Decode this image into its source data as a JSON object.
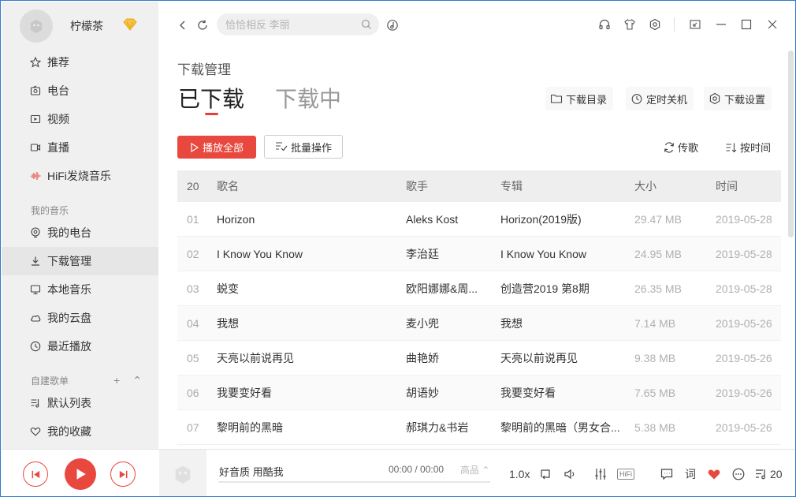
{
  "profile": {
    "username": "柠檬茶"
  },
  "sidebar": {
    "items": [
      {
        "label": "推荐",
        "icon": "star-icon"
      },
      {
        "label": "电台",
        "icon": "radio-icon"
      },
      {
        "label": "视频",
        "icon": "video-icon"
      },
      {
        "label": "直播",
        "icon": "live-icon"
      },
      {
        "label": "HiFi发烧音乐",
        "icon": "hifi-wave-icon"
      }
    ],
    "my_music_title": "我的音乐",
    "my_music": [
      {
        "label": "我的电台",
        "icon": "my-radio-icon"
      },
      {
        "label": "下载管理",
        "icon": "download-icon",
        "active": true
      },
      {
        "label": "本地音乐",
        "icon": "monitor-icon"
      },
      {
        "label": "我的云盘",
        "icon": "cloud-icon"
      },
      {
        "label": "最近播放",
        "icon": "clock-icon"
      }
    ],
    "playlist_title": "自建歌单",
    "playlists": [
      {
        "label": "默认列表",
        "icon": "playlist-icon"
      },
      {
        "label": "我的收藏",
        "icon": "heart-outline-icon"
      }
    ]
  },
  "search": {
    "placeholder": "恰恰相反 李丽"
  },
  "main": {
    "page_title": "下载管理",
    "tabs": [
      "已下载",
      "下载中"
    ],
    "actions": [
      "下载目录",
      "定时关机",
      "下载设置"
    ],
    "play_all": "播放全部",
    "batch": "批量操作",
    "sort_by_song": "传歌",
    "sort_by_time": "按时间"
  },
  "table": {
    "count": "20",
    "headers": [
      "歌名",
      "歌手",
      "专辑",
      "大小",
      "时间"
    ],
    "rows": [
      {
        "idx": "01",
        "name": "Horizon",
        "artist": "Aleks Kost",
        "album": "Horizon(2019版)",
        "size": "29.47 MB",
        "time": "2019-05-28"
      },
      {
        "idx": "02",
        "name": "I Know You Know",
        "artist": "李治廷",
        "album": "I Know You Know",
        "size": "24.95 MB",
        "time": "2019-05-28"
      },
      {
        "idx": "03",
        "name": "蜕变",
        "artist": "欧阳娜娜&周...",
        "album": "创造营2019 第8期",
        "size": "26.35 MB",
        "time": "2019-05-28"
      },
      {
        "idx": "04",
        "name": "我想",
        "artist": "麦小兜",
        "album": "我想",
        "size": "7.14 MB",
        "time": "2019-05-26"
      },
      {
        "idx": "05",
        "name": "天亮以前说再见",
        "artist": "曲艳娇",
        "album": "天亮以前说再见",
        "size": "9.38 MB",
        "time": "2019-05-26"
      },
      {
        "idx": "06",
        "name": "我要变好看",
        "artist": "胡语妙",
        "album": "我要变好看",
        "size": "7.65 MB",
        "time": "2019-05-26"
      },
      {
        "idx": "07",
        "name": "黎明前的黑暗",
        "artist": "郝琪力&书岩",
        "album": "黎明前的黑暗（男女合...",
        "size": "5.38 MB",
        "time": "2019-05-26"
      }
    ]
  },
  "player": {
    "track": "好音质 用酷我",
    "time": "00:00 / 00:00",
    "quality": "高品",
    "speed": "1.0x",
    "hifi": "HiFi",
    "lyrics": "词",
    "queue_count": "20"
  },
  "colors": {
    "accent": "#e8483e",
    "vip": "#f5a623"
  }
}
